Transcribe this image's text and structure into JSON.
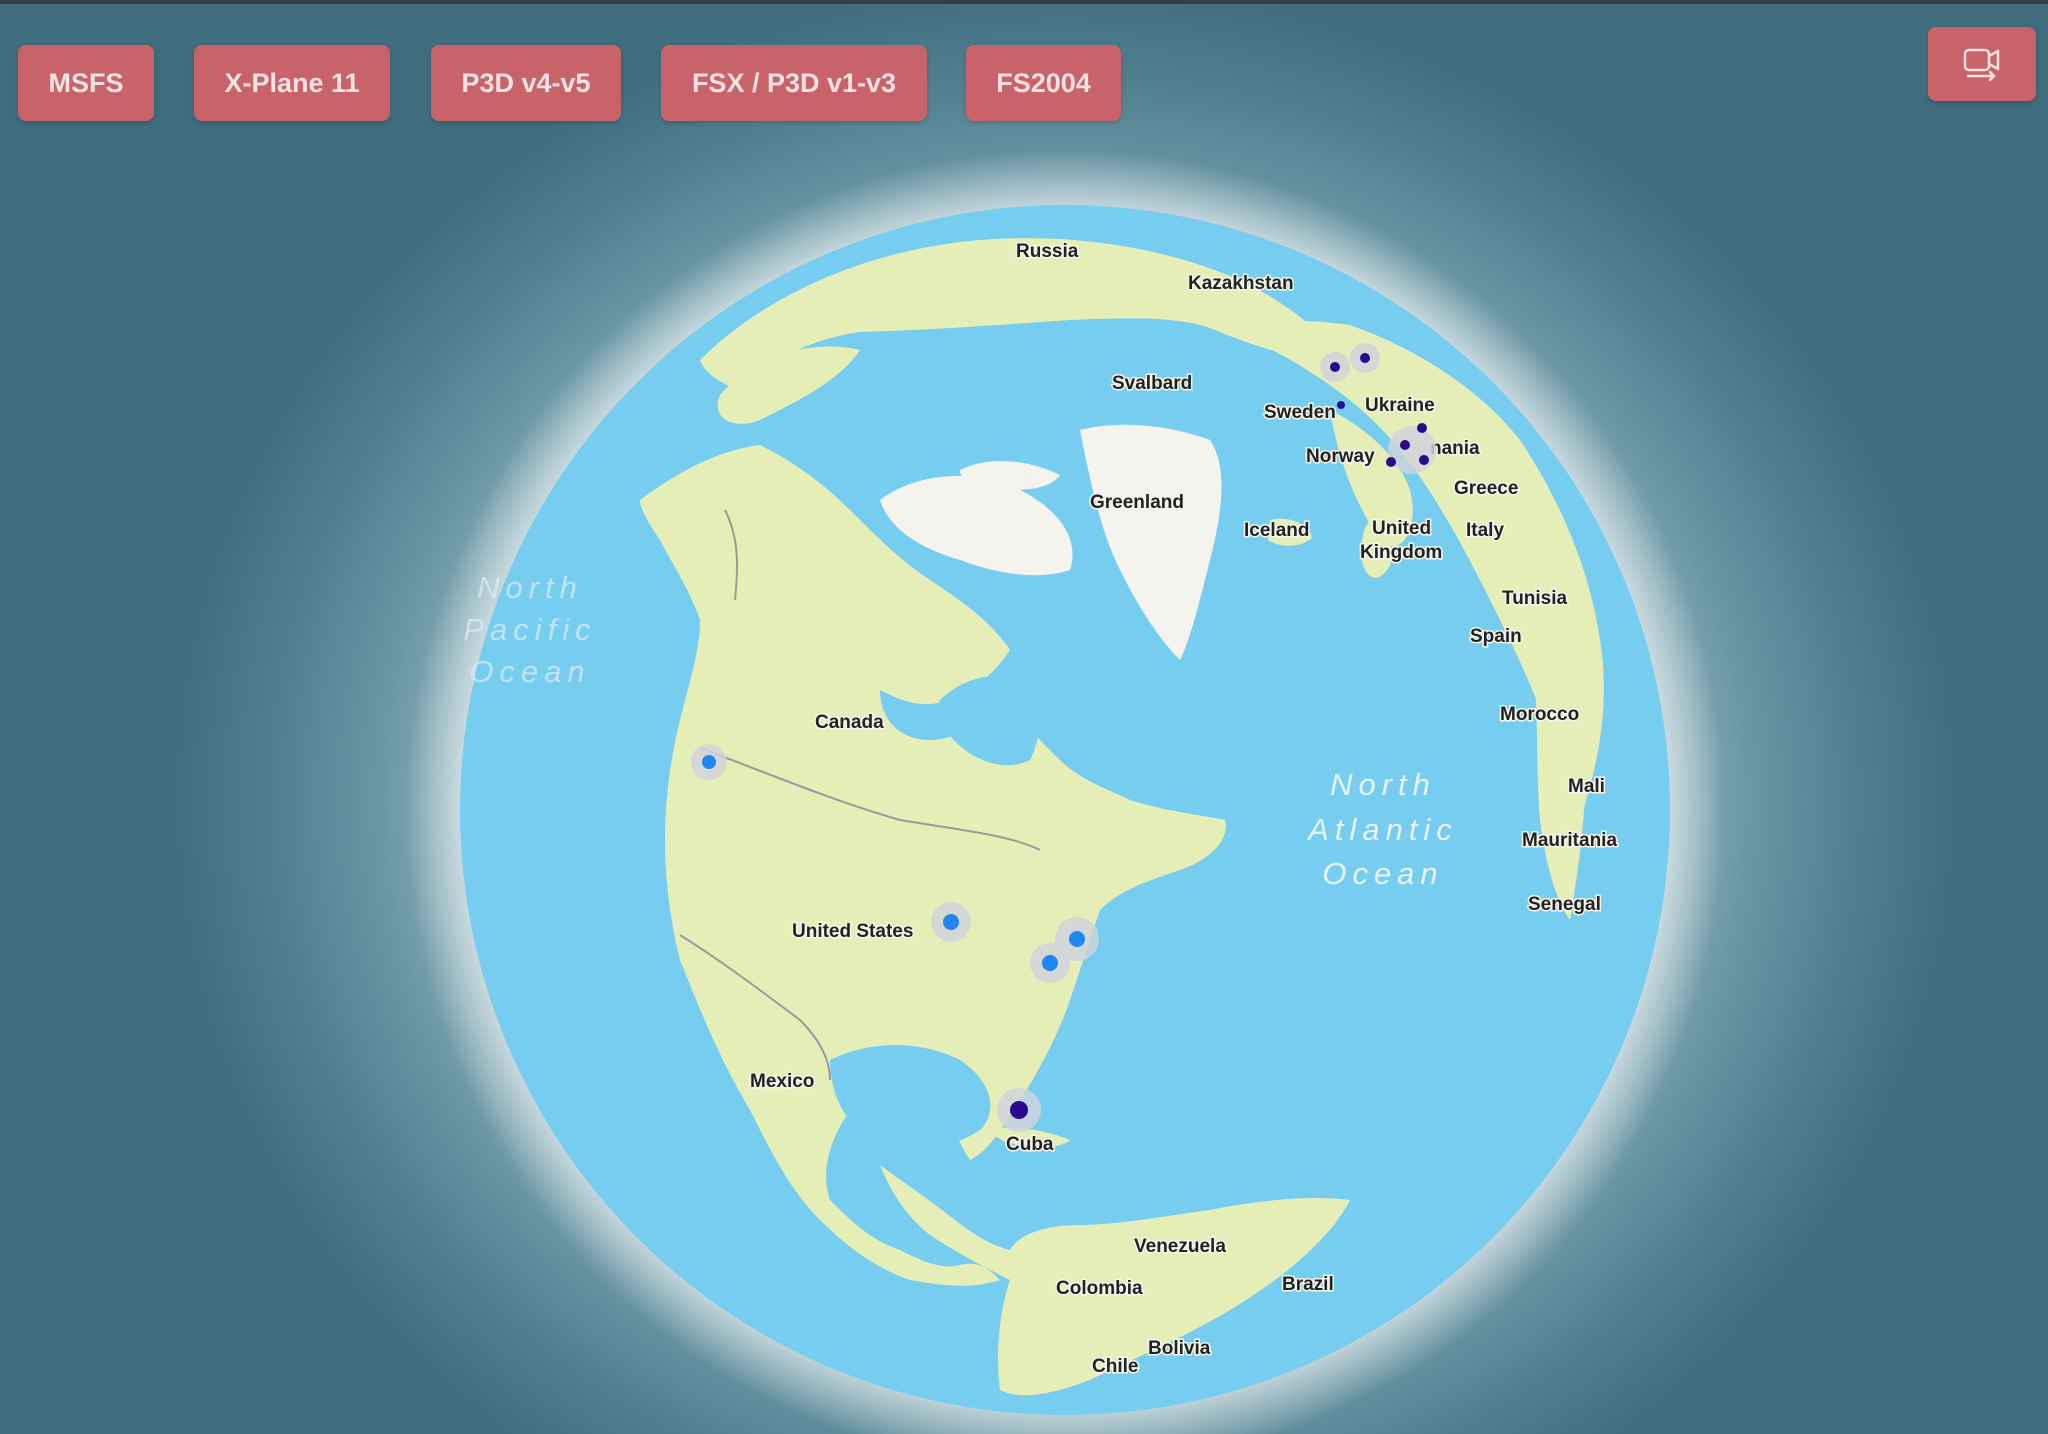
{
  "simulator_tabs": [
    {
      "label": "MSFS"
    },
    {
      "label": "X-Plane 11"
    },
    {
      "label": "P3D v4-v5"
    },
    {
      "label": "FSX / P3D v1-v3"
    },
    {
      "label": "FS2004"
    }
  ],
  "camera_button": {
    "icon": "camera-switch-icon"
  },
  "map": {
    "country_labels": [
      "Russia",
      "Kazakhstan",
      "Svalbard",
      "Sweden",
      "Ukraine",
      "Norway",
      "nania",
      "Greece",
      "Greenland",
      "Iceland",
      "United",
      "Kingdom",
      "Italy",
      "Tunisia",
      "Spain",
      "Morocco",
      "Canada",
      "Mali",
      "Mauritania",
      "Senegal",
      "United States",
      "Mexico",
      "Cuba",
      "Venezuela",
      "Colombia",
      "Brazil",
      "Bolivia",
      "Chile"
    ],
    "ocean_labels": [
      {
        "lines": [
          "North",
          "Pacific",
          "Ocean"
        ]
      },
      {
        "lines": [
          "North",
          "Atlantic",
          "Ocean"
        ]
      }
    ],
    "colors": {
      "ocean": "#76cdf0",
      "land": "#e6eeb8",
      "ice": "#f4f3ee",
      "marker_blue": "#1f86f3",
      "marker_purple": "#2a0a8c"
    }
  }
}
